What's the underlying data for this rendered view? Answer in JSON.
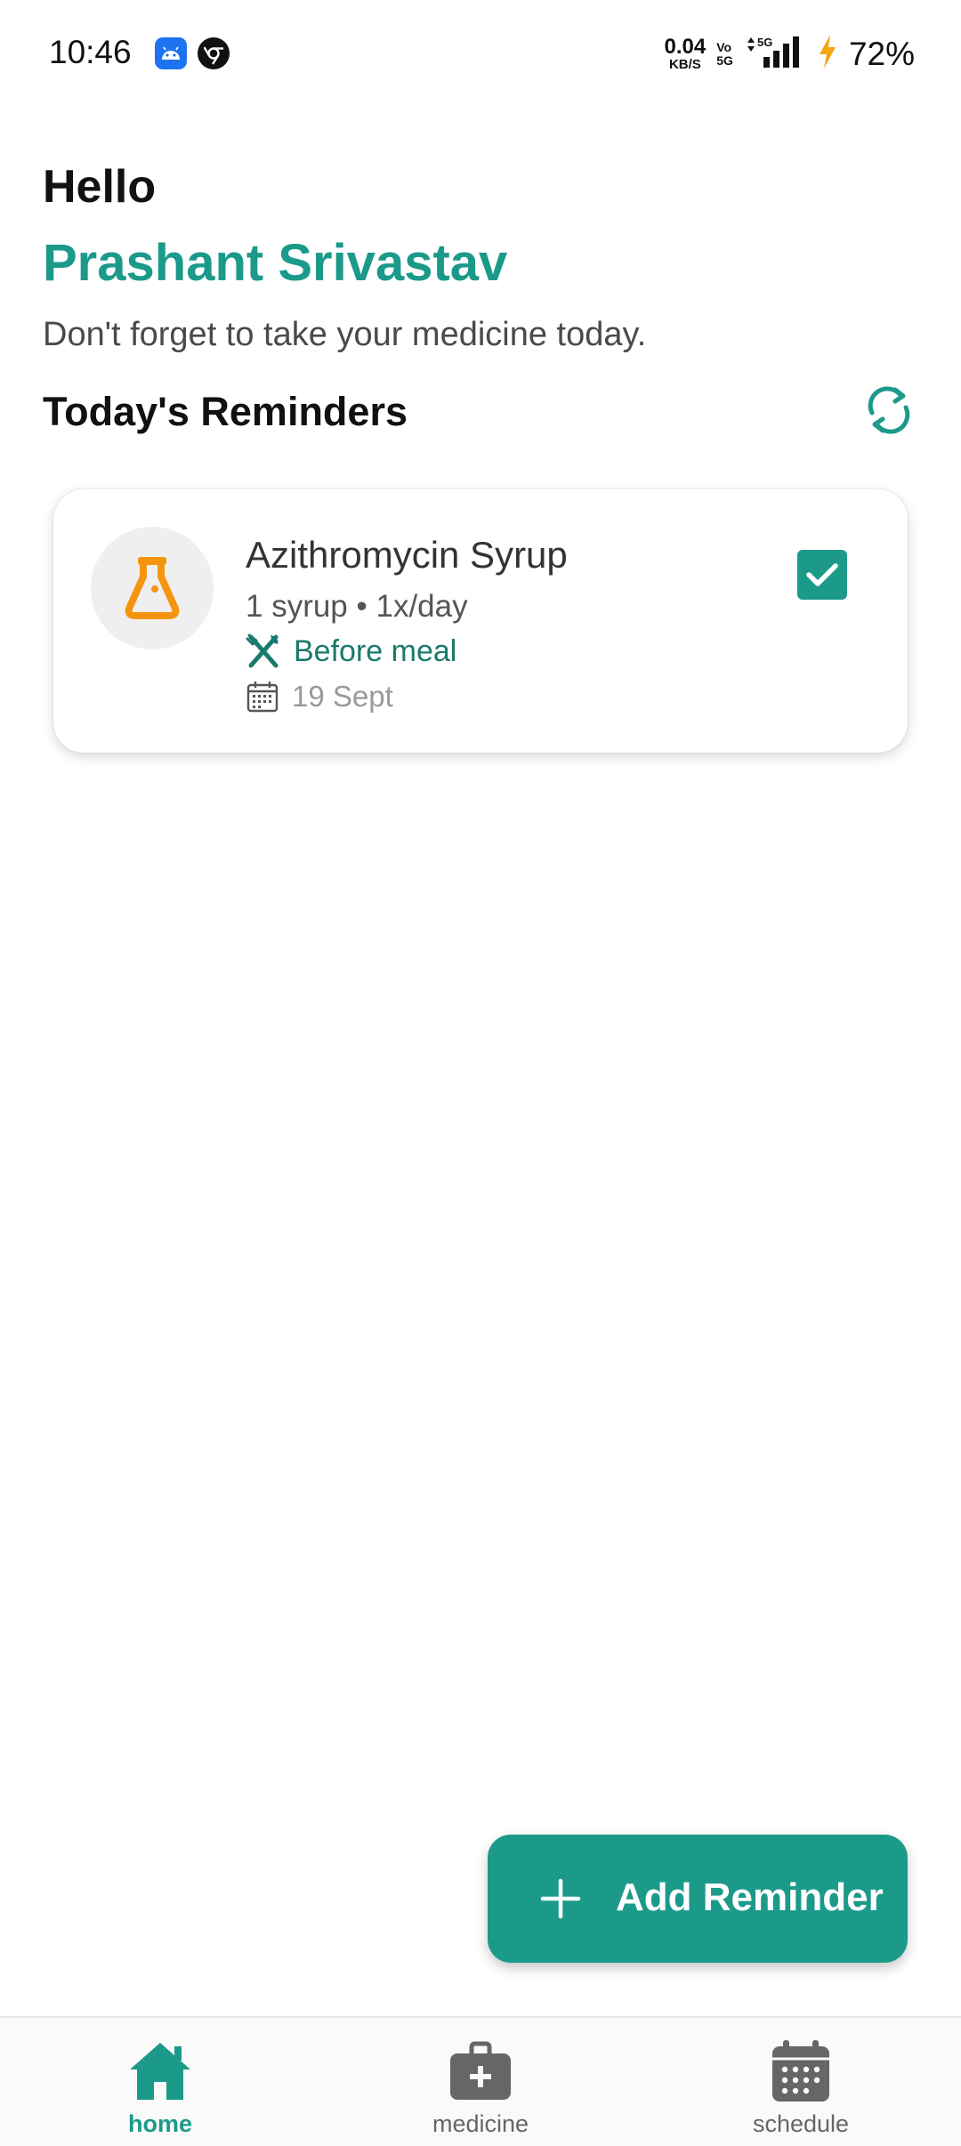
{
  "status_bar": {
    "time": "10:46",
    "net_speed_value": "0.04",
    "net_speed_unit": "KB/S",
    "vo_line1": "Vo",
    "vo_line2": "5G",
    "network_label": "5G",
    "battery_percent": "72%"
  },
  "header": {
    "greeting": "Hello",
    "user_name": "Prashant Srivastav",
    "subtitle": "Don't forget to take your medicine today.",
    "section_title": "Today's Reminders"
  },
  "reminders": [
    {
      "name": "Azithromycin Syrup",
      "dosage": "1 syrup • 1x/day",
      "meal": "Before meal",
      "date": "19 Sept",
      "checked": true,
      "icon": "flask-icon"
    }
  ],
  "fab": {
    "label": "Add Reminder"
  },
  "bottom_nav": {
    "items": [
      {
        "label": "home",
        "icon": "home-icon",
        "active": true
      },
      {
        "label": "medicine",
        "icon": "medicine-kit-icon",
        "active": false
      },
      {
        "label": "schedule",
        "icon": "calendar-icon",
        "active": false
      }
    ]
  },
  "colors": {
    "accent": "#1b9a8a",
    "meal_text": "#1a7a6c",
    "flask_orange": "#f5950f",
    "nav_inactive": "#666666"
  }
}
